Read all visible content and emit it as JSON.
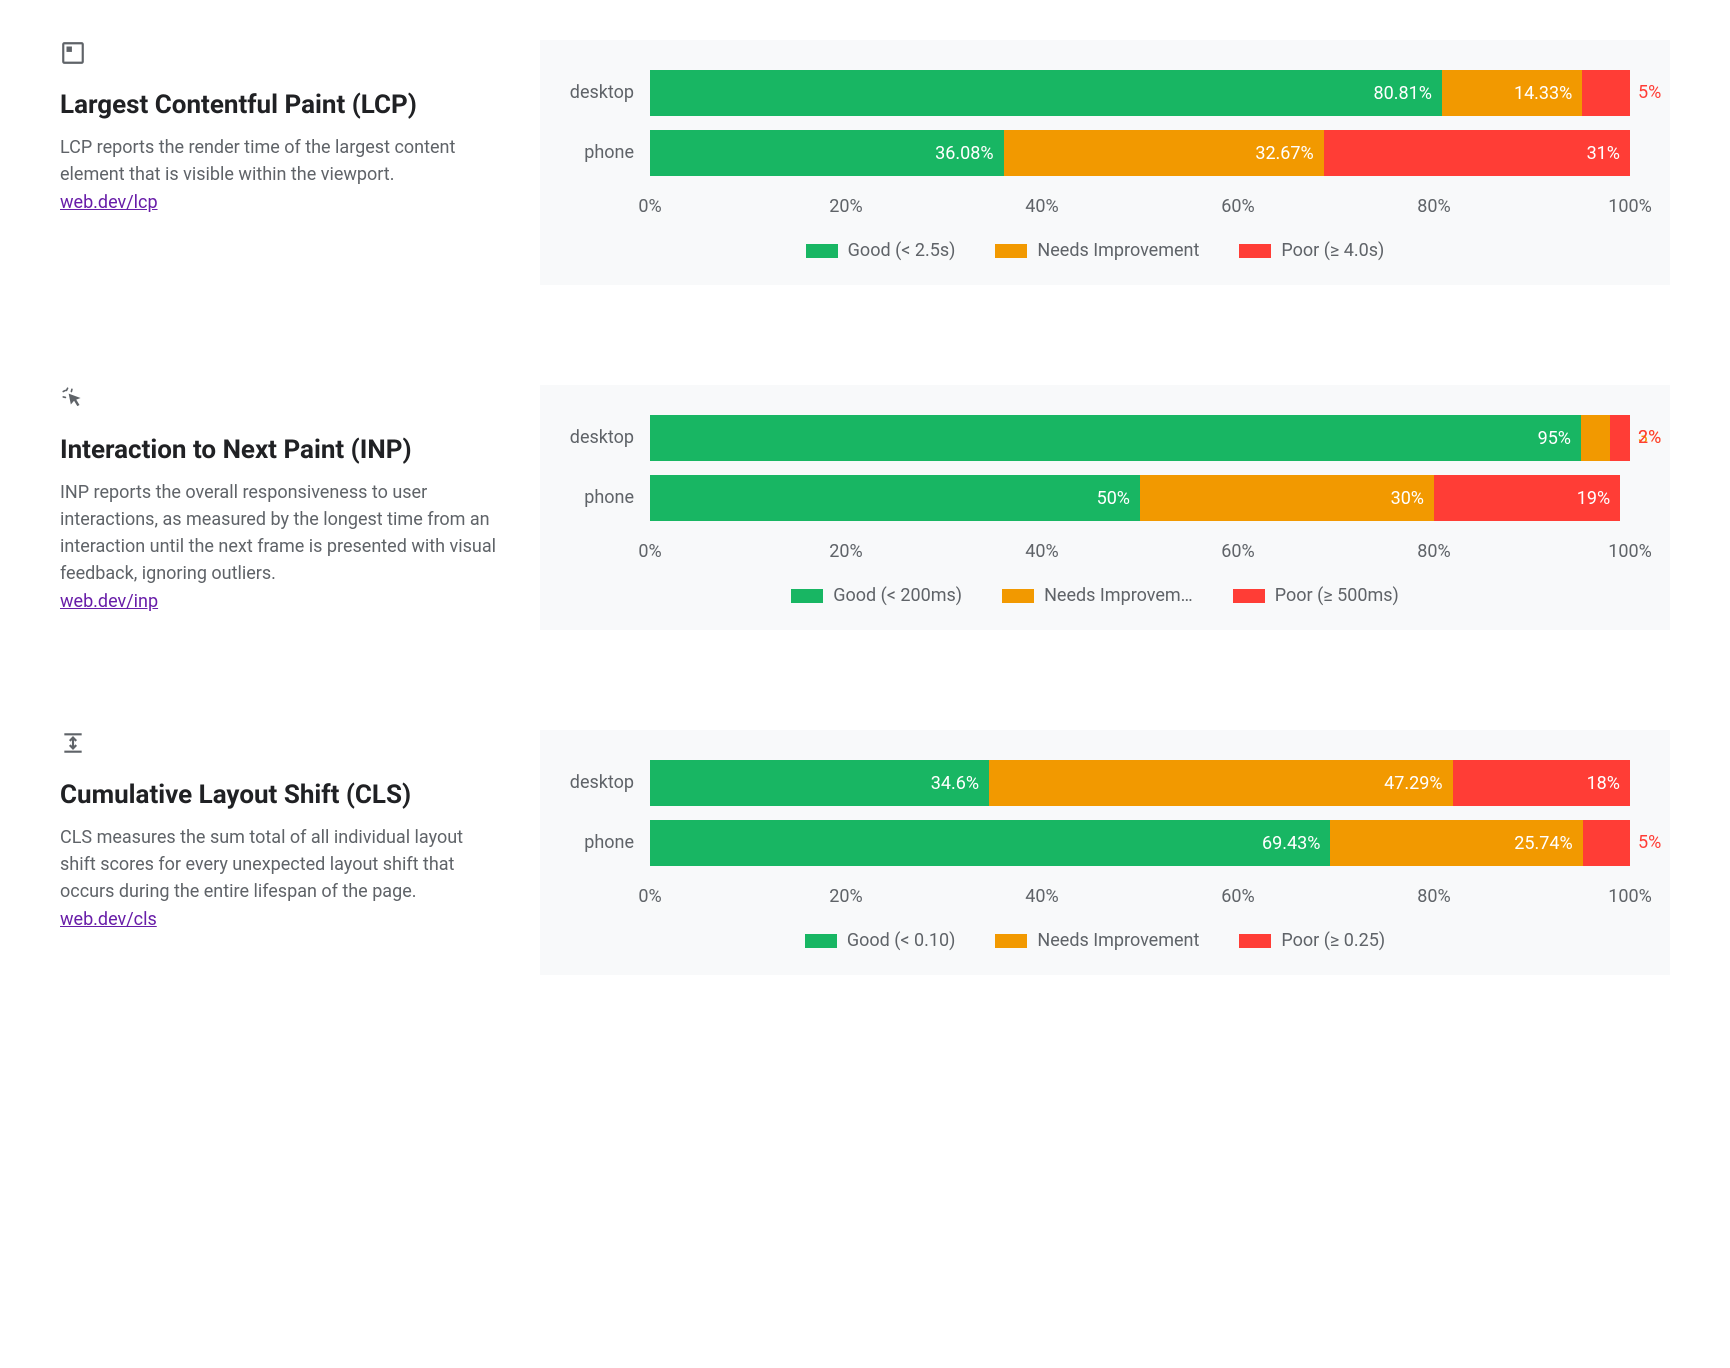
{
  "colors": {
    "good": "#18b663",
    "warn": "#f29900",
    "poor": "#ff3d36"
  },
  "axis_ticks": [
    "0%",
    "20%",
    "40%",
    "60%",
    "80%",
    "100%"
  ],
  "metrics": [
    {
      "id": "lcp",
      "icon": "fullscreen-icon",
      "title": "Largest Contentful Paint (LCP)",
      "description": "LCP reports the render time of the largest content element that is visible within the viewport.",
      "link_text": "web.dev/lcp",
      "legend": {
        "good": "Good (< 2.5s)",
        "warn": "Needs Improvement",
        "poor": "Poor (≥ 4.0s)"
      }
    },
    {
      "id": "inp",
      "icon": "cursor-click-icon",
      "title": "Interaction to Next Paint (INP)",
      "description": "INP reports the overall responsiveness to user interactions, as measured by the longest time from an interaction until the next frame is presented with visual feedback, ignoring outliers.",
      "link_text": "web.dev/inp",
      "legend": {
        "good": "Good (< 200ms)",
        "warn": "Needs Improvem…",
        "poor": "Poor (≥ 500ms)"
      }
    },
    {
      "id": "cls",
      "icon": "layout-shift-icon",
      "title": "Cumulative Layout Shift (CLS)",
      "description": "CLS measures the sum total of all individual layout shift scores for every unexpected layout shift that occurs during the entire lifespan of the page.",
      "link_text": "web.dev/cls",
      "legend": {
        "good": "Good (< 0.10)",
        "warn": "Needs Improvement",
        "poor": "Poor (≥ 0.25)"
      }
    }
  ],
  "chart_data": [
    {
      "metric": "lcp",
      "type": "bar",
      "orientation": "horizontal",
      "stacked": true,
      "categories": [
        "desktop",
        "phone"
      ],
      "series": [
        {
          "name": "Good (< 2.5s)",
          "values": [
            80.81,
            36.08
          ],
          "labels": [
            "80.81%",
            "36.08%"
          ]
        },
        {
          "name": "Needs Improvement",
          "values": [
            14.33,
            32.67
          ],
          "labels": [
            "14.33%",
            "32.67%"
          ]
        },
        {
          "name": "Poor (≥ 4.0s)",
          "values": [
            4.86,
            31.25
          ],
          "labels": [
            "5%",
            "31%"
          ]
        }
      ],
      "xlim": [
        0,
        100
      ],
      "xlabel": "",
      "ylabel": ""
    },
    {
      "metric": "inp",
      "type": "bar",
      "orientation": "horizontal",
      "stacked": true,
      "categories": [
        "desktop",
        "phone"
      ],
      "series": [
        {
          "name": "Good (< 200ms)",
          "values": [
            95,
            50
          ],
          "labels": [
            "95%",
            "50%"
          ]
        },
        {
          "name": "Needs Improvement",
          "values": [
            3,
            30
          ],
          "labels": [
            "3%",
            "30%"
          ]
        },
        {
          "name": "Poor (≥ 500ms)",
          "values": [
            2,
            19
          ],
          "labels": [
            "2%",
            "19%"
          ]
        }
      ],
      "xlim": [
        0,
        100
      ],
      "xlabel": "",
      "ylabel": ""
    },
    {
      "metric": "cls",
      "type": "bar",
      "orientation": "horizontal",
      "stacked": true,
      "categories": [
        "desktop",
        "phone"
      ],
      "series": [
        {
          "name": "Good (< 0.10)",
          "values": [
            34.6,
            69.43
          ],
          "labels": [
            "34.6%",
            "69.43%"
          ]
        },
        {
          "name": "Needs Improvement",
          "values": [
            47.29,
            25.74
          ],
          "labels": [
            "47.29%",
            "25.74%"
          ]
        },
        {
          "name": "Poor (≥ 0.25)",
          "values": [
            18.11,
            4.83
          ],
          "labels": [
            "18%",
            "5%"
          ]
        }
      ],
      "xlim": [
        0,
        100
      ],
      "xlabel": "",
      "ylabel": ""
    }
  ]
}
